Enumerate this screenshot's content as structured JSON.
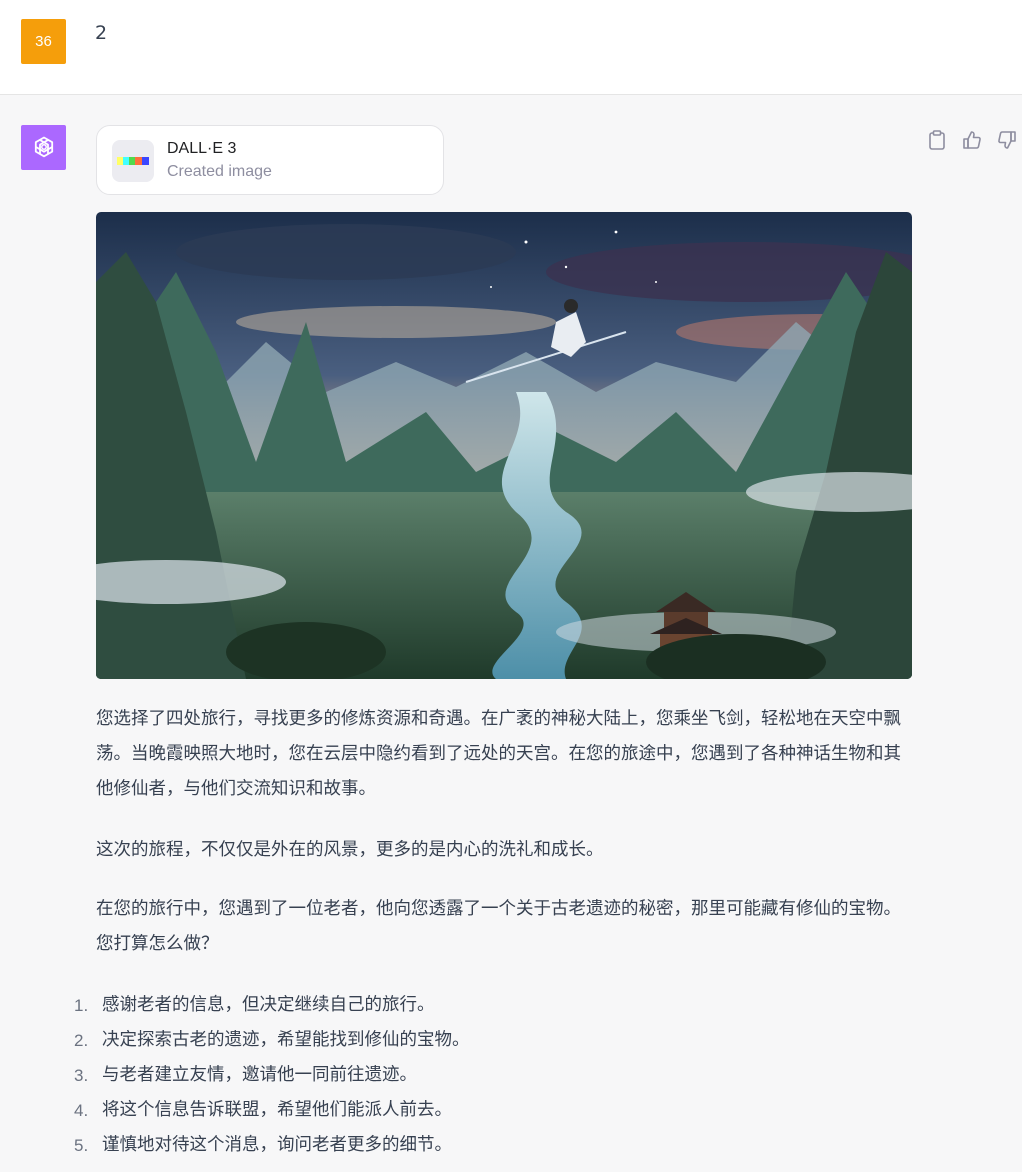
{
  "user_message": {
    "avatar_text": "36",
    "text": "2",
    "avatar_color": "#f59e0b"
  },
  "assistant": {
    "avatar_icon": "openai-logo-icon",
    "avatar_color": "#ab68ff",
    "tool": {
      "name": "DALL·E 3",
      "status": "Created image"
    },
    "actions": [
      "copy-icon",
      "thumbs-up-icon",
      "thumbs-down-icon"
    ],
    "image_icon": "generated-landscape-image",
    "paragraphs": [
      "您选择了四处旅行，寻找更多的修炼资源和奇遇。在广袤的神秘大陆上，您乘坐飞剑，轻松地在天空中飘荡。当晚霞映照大地时，您在云层中隐约看到了远处的天宫。在您的旅途中，您遇到了各种神话生物和其他修仙者，与他们交流知识和故事。",
      "这次的旅程，不仅仅是外在的风景，更多的是内心的洗礼和成长。",
      "在您的旅行中，您遇到了一位老者，他向您透露了一个关于古老遗迹的秘密，那里可能藏有修仙的宝物。您打算怎么做？"
    ],
    "options": [
      {
        "num": "1.",
        "text": "感谢老者的信息，但决定继续自己的旅行。"
      },
      {
        "num": "2.",
        "text": "决定探索古老的遗迹，希望能找到修仙的宝物。"
      },
      {
        "num": "3.",
        "text": "与老者建立友情，邀请他一同前往遗迹。"
      },
      {
        "num": "4.",
        "text": "将这个信息告诉联盟，希望他们能派人前去。"
      },
      {
        "num": "5.",
        "text": "谨慎地对待这个消息，询问老者更多的细节。"
      }
    ]
  }
}
